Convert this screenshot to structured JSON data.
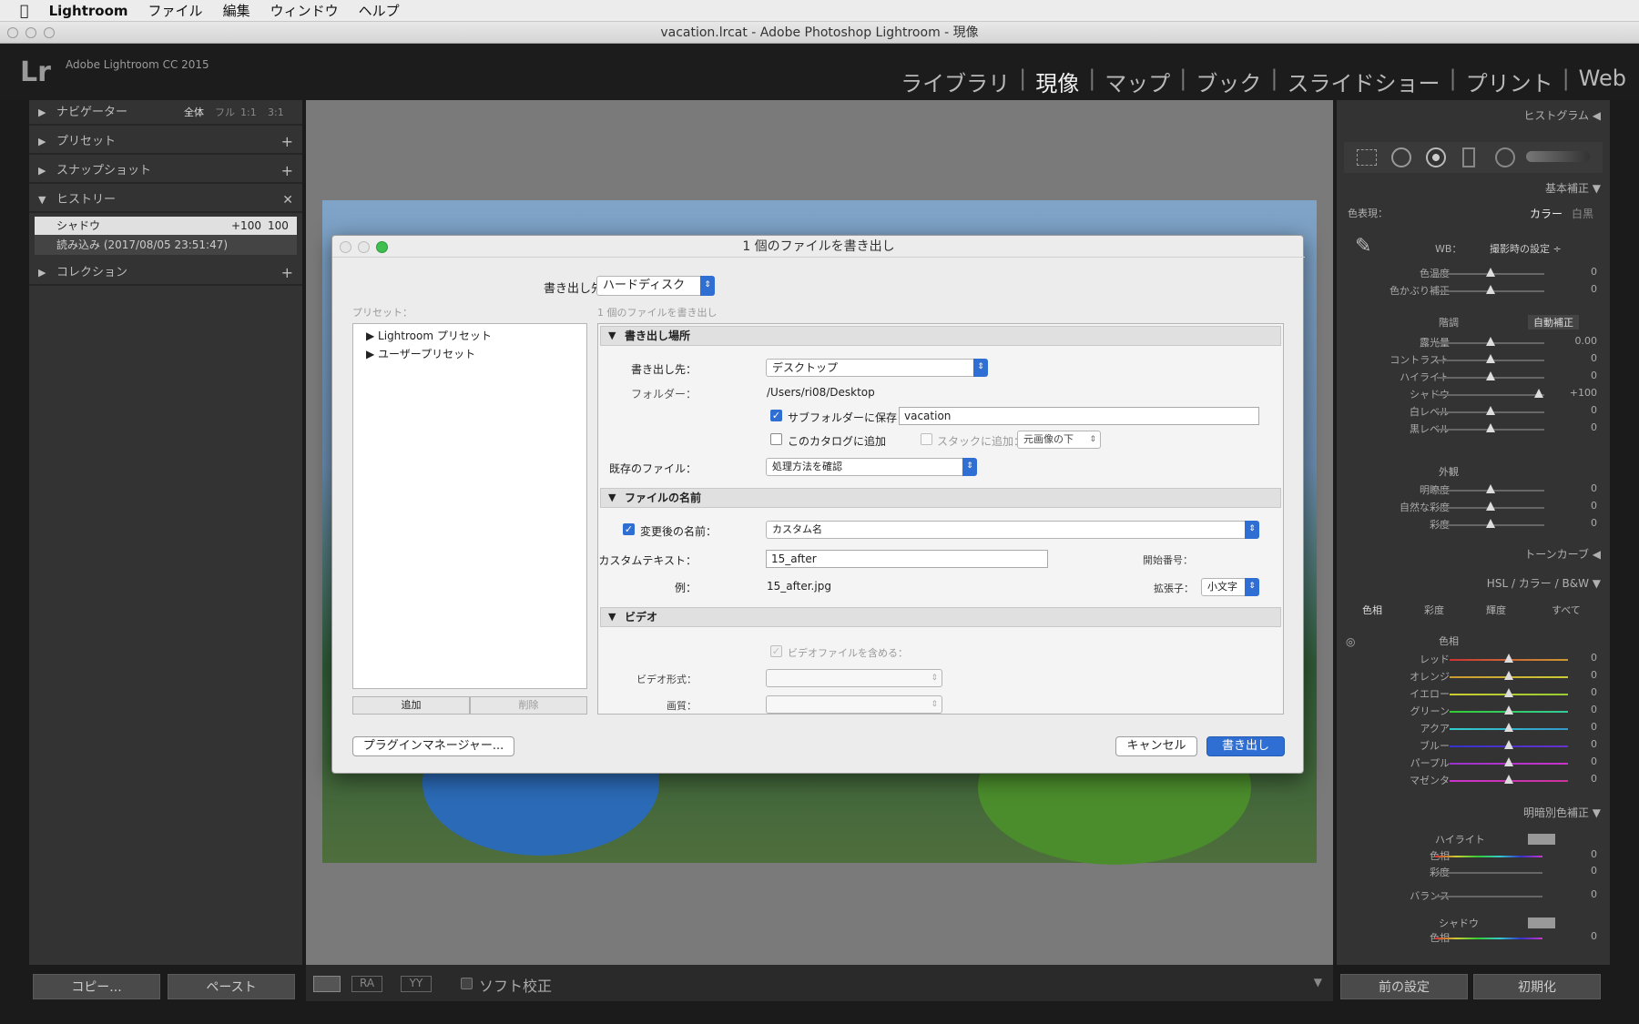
{
  "menubar": {
    "apple": "",
    "app": "Lightroom",
    "items": [
      "ファイル",
      "編集",
      "ウィンドウ",
      "ヘルプ"
    ]
  },
  "window": {
    "title": "vacation.lrcat - Adobe Photoshop Lightroom - 現像"
  },
  "topbar": {
    "logo": "Lr",
    "version": "Adobe Lightroom CC 2015",
    "modules": [
      "ライブラリ",
      "現像",
      "マップ",
      "ブック",
      "スライドショー",
      "プリント",
      "Web"
    ],
    "active_module": "現像"
  },
  "left": {
    "navigator": {
      "title": "ナビゲーター",
      "zoom": [
        "全体",
        "フル",
        "1:1",
        "3:1"
      ]
    },
    "presets": "プリセット",
    "snapshots": "スナップショット",
    "history": {
      "title": "ヒストリー",
      "rows": [
        {
          "label": "シャドウ",
          "delta": "+100",
          "value": "100"
        },
        {
          "label": "読み込み (2017/08/05 23:51:47)"
        }
      ]
    },
    "collections": "コレクション",
    "copy": "コピー...",
    "paste": "ペースト"
  },
  "toolbar": {
    "soft_proof": "ソフト校正"
  },
  "dialog": {
    "title": "1 個のファイルを書き出し",
    "export_to_label": "書き出し先：",
    "export_to": "ハードディスク",
    "preset_label": "プリセット：",
    "subtitle": "1 個のファイルを書き出し",
    "presets": [
      "Lightroom プリセット",
      "ユーザープリセット"
    ],
    "add": "追加",
    "remove": "削除",
    "location": {
      "header": "書き出し場所",
      "dest_label": "書き出し先：",
      "dest": "デスクトップ",
      "folder_label": "フォルダー：",
      "folder": "/Users/ri08/Desktop",
      "subfolder_label": "サブフォルダーに保存：",
      "subfolder": "vacation",
      "add_catalog": "このカタログに追加",
      "add_stack": "スタックに追加：",
      "stack_opt": "元画像の下",
      "existing_label": "既存のファイル：",
      "existing": "処理方法を確認"
    },
    "naming": {
      "header": "ファイルの名前",
      "rename_label": "変更後の名前：",
      "rename": "カスタム名",
      "custom_label": "カスタムテキスト：",
      "custom": "15_after",
      "start_label": "開始番号：",
      "example_label": "例：",
      "example": "15_after.jpg",
      "ext_label": "拡張子：",
      "ext": "小文字"
    },
    "video": {
      "header": "ビデオ",
      "include": "ビデオファイルを含める：",
      "format_label": "ビデオ形式：",
      "quality_label": "画質："
    },
    "plugin": "プラグインマネージャー...",
    "cancel": "キャンセル",
    "export": "書き出し"
  },
  "right": {
    "histogram": "ヒストグラム",
    "basic": "基本補正",
    "treatment_label": "色表現：",
    "color": "カラー",
    "bw": "白黒",
    "wb_label": "WB：",
    "wb": "撮影時の設定 ÷",
    "tone": "階調",
    "auto": "自動補正",
    "presence": "外観",
    "rows1": [
      {
        "label": "色温度",
        "value": "0",
        "pos": 0.5
      },
      {
        "label": "色かぶり補正",
        "value": "0",
        "pos": 0.5
      }
    ],
    "rows2": [
      {
        "label": "露光量",
        "value": "0.00",
        "pos": 0.5
      },
      {
        "label": "コントラスト",
        "value": "0",
        "pos": 0.5
      },
      {
        "label": "ハイライト",
        "value": "0",
        "pos": 0.5
      },
      {
        "label": "シャドウ",
        "value": "+100",
        "pos": 0.95
      },
      {
        "label": "白レベル",
        "value": "0",
        "pos": 0.5
      },
      {
        "label": "黒レベル",
        "value": "0",
        "pos": 0.5
      }
    ],
    "rows3": [
      {
        "label": "明瞭度",
        "value": "0",
        "pos": 0.5
      },
      {
        "label": "自然な彩度",
        "value": "0",
        "pos": 0.5
      },
      {
        "label": "彩度",
        "value": "0",
        "pos": 0.5
      }
    ],
    "tone_curve": "トーンカーブ",
    "hsl": {
      "title": "HSL",
      "color": "カラー",
      "bw": "B&W",
      "tabs": [
        "色相",
        "彩度",
        "輝度",
        "すべて"
      ],
      "group": "色相",
      "rows": [
        {
          "label": "レッド",
          "value": "0"
        },
        {
          "label": "オレンジ",
          "value": "0"
        },
        {
          "label": "イエロー",
          "value": "0"
        },
        {
          "label": "グリーン",
          "value": "0"
        },
        {
          "label": "アクア",
          "value": "0"
        },
        {
          "label": "ブルー",
          "value": "0"
        },
        {
          "label": "パープル",
          "value": "0"
        },
        {
          "label": "マゼンタ",
          "value": "0"
        }
      ]
    },
    "split": {
      "title": "明暗別色補正",
      "highlight": "ハイライト",
      "hue": "色相",
      "sat": "彩度",
      "balance": "バランス",
      "shadow": "シャドウ",
      "hue2": "色相",
      "values": [
        "0",
        "0",
        "0",
        "0"
      ]
    },
    "prev": "前の設定",
    "reset": "初期化"
  }
}
